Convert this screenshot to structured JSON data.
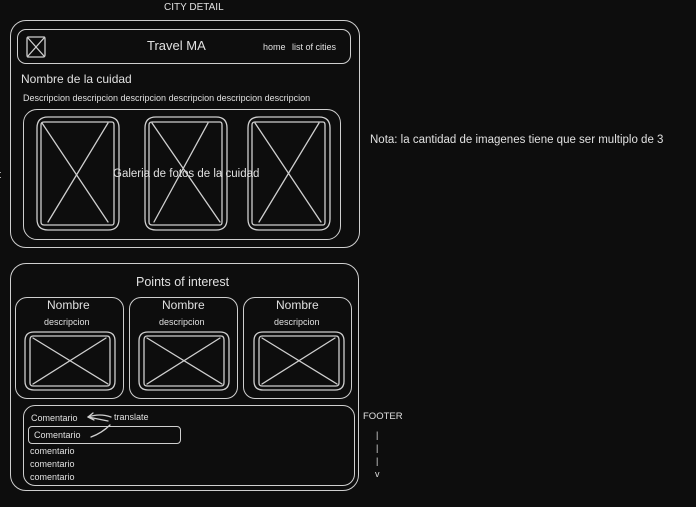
{
  "page_label": "CITY DETAIL",
  "header": {
    "logo_icon": "placeholder-image-icon",
    "title": "Travel MA",
    "nav": [
      "home",
      "list of cities"
    ]
  },
  "city": {
    "name": "Nombre de la cuidad",
    "description": "Descripcion descripcion descripcion descripcion descripcion descripcion",
    "gallery_label": "Galeria de fotos de la cuidad",
    "gallery_count": 3
  },
  "note": "Nota: la cantidad de imagenes tiene que ser multiplo de 3",
  "side_mark": "t",
  "points": {
    "title": "Points of interest",
    "cards": [
      {
        "name": "Nombre",
        "description": "descripcion"
      },
      {
        "name": "Nombre",
        "description": "descripcion"
      },
      {
        "name": "Nombre",
        "description": "descripcion"
      }
    ]
  },
  "comments": {
    "first": "Comentario",
    "translate": "translate",
    "translated": "Comentario",
    "items": [
      "comentario",
      "comentario",
      "comentario"
    ]
  },
  "footer": {
    "label": "FOOTER",
    "arrow_marks": [
      "|",
      "|",
      "|",
      "v"
    ]
  },
  "colors": {
    "background": "#0d0d0d",
    "stroke": "#cfcfcf",
    "text": "#e0e0e0"
  }
}
